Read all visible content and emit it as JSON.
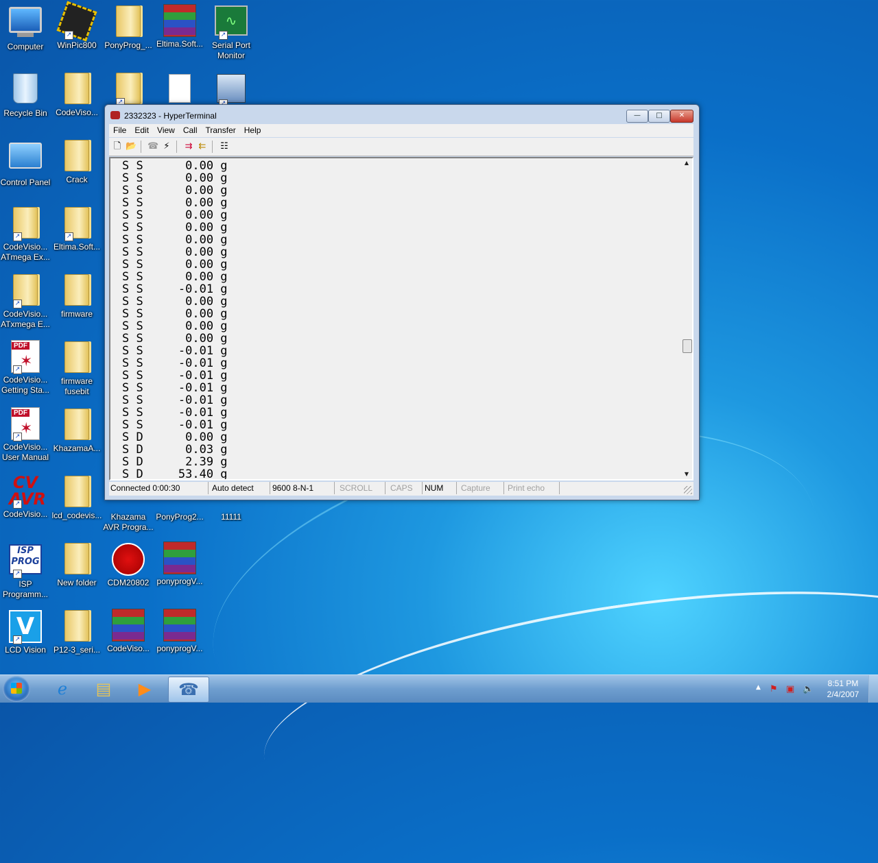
{
  "desktop": {
    "icons": [
      {
        "label": "Computer",
        "kind": "computer"
      },
      {
        "label": "WinPic800",
        "kind": "chip"
      },
      {
        "label": "PonyProg_...",
        "kind": "folder"
      },
      {
        "label": "Eltima.Soft...",
        "kind": "rar"
      },
      {
        "label": "Serial Port Monitor",
        "kind": "monitor"
      },
      {
        "label": "Recycle Bin",
        "kind": "bin"
      },
      {
        "label": "CodeViso...",
        "kind": "folder"
      },
      {
        "label": "",
        "kind": "folder"
      },
      {
        "label": "",
        "kind": "file"
      },
      {
        "label": "",
        "kind": "setup"
      },
      {
        "label": "Control Panel",
        "kind": "control"
      },
      {
        "label": "Crack",
        "kind": "folder"
      },
      {
        "label": "CodeVisio... ATmega Ex...",
        "kind": "folder"
      },
      {
        "label": "Eltima.Soft...",
        "kind": "folder"
      },
      {
        "label": "CodeVisio... ATxmega E...",
        "kind": "folder"
      },
      {
        "label": "firmware",
        "kind": "folder"
      },
      {
        "label": "CodeVisio... Getting Sta...",
        "kind": "pdf"
      },
      {
        "label": "firmware fusebit",
        "kind": "folder"
      },
      {
        "label": "CodeVisio... User Manual",
        "kind": "pdf"
      },
      {
        "label": "KhazamaA...",
        "kind": "folder"
      },
      {
        "label": "CodeVisio...",
        "kind": "cvavr"
      },
      {
        "label": "lcd_codevis...",
        "kind": "folder"
      },
      {
        "label": "Khazama AVR Progra...",
        "kind": "app"
      },
      {
        "label": "PonyProg2...",
        "kind": "app"
      },
      {
        "label": "11111",
        "kind": "app"
      },
      {
        "label": "ISP Programm...",
        "kind": "isp"
      },
      {
        "label": "New folder",
        "kind": "folder"
      },
      {
        "label": "CDM20802",
        "kind": "cdm"
      },
      {
        "label": "ponyprogV...",
        "kind": "rar"
      },
      {
        "label": "LCD Vision",
        "kind": "lcdv"
      },
      {
        "label": "P12-3_seri...",
        "kind": "folder"
      },
      {
        "label": "CodeViso...",
        "kind": "rar"
      },
      {
        "label": "ponyprogV...",
        "kind": "rar"
      }
    ]
  },
  "window": {
    "title": "2332323 - HyperTerminal",
    "controls": {
      "minimize": "—",
      "maximize": "□",
      "close": "✕"
    },
    "menu": [
      "File",
      "Edit",
      "View",
      "Call",
      "Transfer",
      "Help"
    ],
    "toolbar_icons": [
      "new-icon",
      "open-icon",
      "disconnect-icon",
      "connect-icon",
      "send-icon",
      "receive-icon",
      "properties-icon"
    ],
    "terminal_lines": [
      "S S      0.00 g",
      "S S      0.00 g",
      "S S      0.00 g",
      "S S      0.00 g",
      "S S      0.00 g",
      "S S      0.00 g",
      "S S      0.00 g",
      "S S      0.00 g",
      "S S      0.00 g",
      "S S      0.00 g",
      "S S     -0.01 g",
      "S S      0.00 g",
      "S S      0.00 g",
      "S S      0.00 g",
      "S S      0.00 g",
      "S S     -0.01 g",
      "S S     -0.01 g",
      "S S     -0.01 g",
      "S S     -0.01 g",
      "S S     -0.01 g",
      "S S     -0.01 g",
      "S S     -0.01 g",
      "S D      0.00 g",
      "S D      0.03 g",
      "S D      2.39 g",
      "S D     53.40 g"
    ],
    "status": {
      "connection": "Connected 0:00:30",
      "detect": "Auto detect",
      "settings": "9600 8-N-1",
      "scroll": "SCROLL",
      "caps": "CAPS",
      "num": "NUM",
      "capture": "Capture",
      "print_echo": "Print echo"
    }
  },
  "taskbar": {
    "clock_time": "8:51 PM",
    "clock_date": "2/4/2007"
  }
}
